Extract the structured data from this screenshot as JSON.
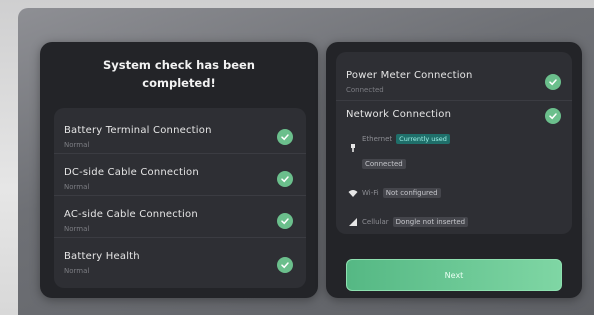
{
  "left_panel": {
    "title_line1": "System check has been",
    "title_line2": "completed!",
    "items": [
      {
        "label": "Battery Terminal Connection",
        "status": "Normal"
      },
      {
        "label": "DC-side Cable Connection",
        "status": "Normal"
      },
      {
        "label": "AC-side Cable Connection",
        "status": "Normal"
      },
      {
        "label": "Battery Health",
        "status": "Normal"
      }
    ]
  },
  "right_panel": {
    "power_meter": {
      "label": "Power Meter Connection",
      "status": "Connected"
    },
    "network": {
      "label": "Network Connection"
    },
    "ethernet": {
      "name": "Ethernet",
      "tag": "Currently used",
      "status": "Connected"
    },
    "wifi": {
      "name": "Wi-Fi",
      "status": "Not configured"
    },
    "cellular": {
      "name": "Cellular",
      "status": "Dongle not inserted"
    },
    "next_label": "Next"
  },
  "colors": {
    "check": "#6bbf8c",
    "next": "#6cc796",
    "panel": "#232428"
  }
}
